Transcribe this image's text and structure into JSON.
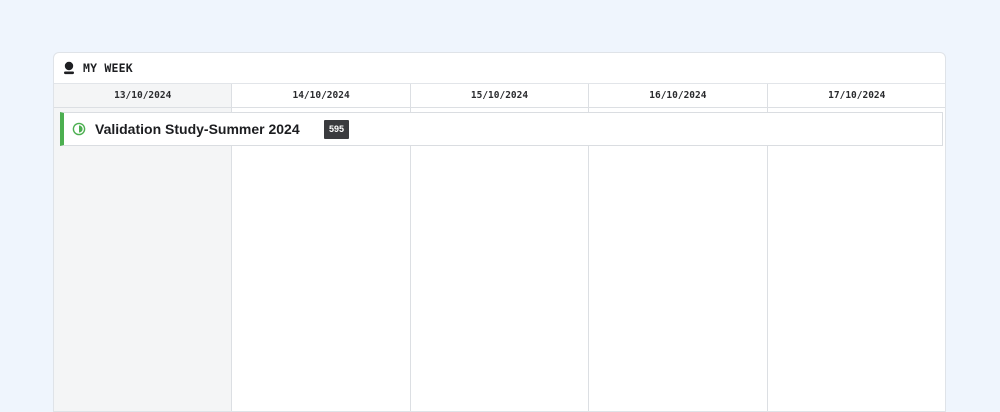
{
  "panel": {
    "title": "MY WEEK",
    "icon": "person-icon"
  },
  "days": [
    {
      "label": "13/10/2024",
      "highlighted": true
    },
    {
      "label": "14/10/2024",
      "highlighted": false
    },
    {
      "label": "15/10/2024",
      "highlighted": false
    },
    {
      "label": "16/10/2024",
      "highlighted": false
    },
    {
      "label": "17/10/2024",
      "highlighted": false
    }
  ],
  "event": {
    "title": "Validation Study-Summer 2024",
    "badge": "595",
    "status_icon": "half-circle-icon",
    "accent_color": "#4caf50"
  },
  "colors": {
    "background": "#eff5fd",
    "today_column": "#f4f5f6",
    "badge": "#3a3b3e"
  }
}
